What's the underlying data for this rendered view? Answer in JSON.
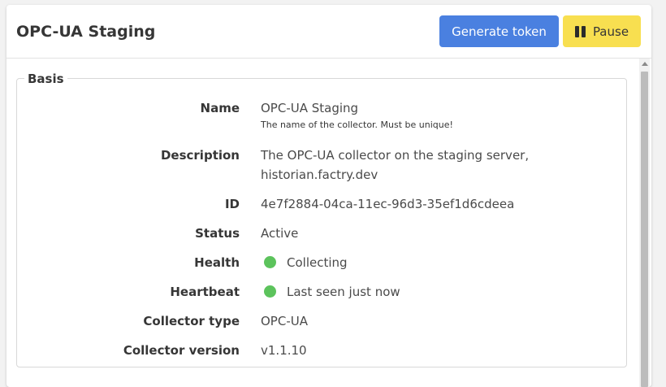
{
  "header": {
    "title": "OPC-UA Staging",
    "generate_token_label": "Generate token",
    "pause_label": "Pause"
  },
  "basis": {
    "legend": "Basis",
    "fields": {
      "name": {
        "label": "Name",
        "value": "OPC-UA Staging",
        "help": "The name of the collector. Must be unique!"
      },
      "description": {
        "label": "Description",
        "value": "The OPC-UA collector on the staging server, historian.factry.dev"
      },
      "id": {
        "label": "ID",
        "value": "4e7f2884-04ca-11ec-96d3-35ef1d6cdeea"
      },
      "status": {
        "label": "Status",
        "value": "Active"
      },
      "health": {
        "label": "Health",
        "value": "Collecting"
      },
      "heartbeat": {
        "label": "Heartbeat",
        "value": "Last seen just now"
      },
      "collector_type": {
        "label": "Collector type",
        "value": "OPC-UA"
      },
      "collector_version": {
        "label": "Collector version",
        "value": "v1.1.10"
      }
    }
  },
  "colors": {
    "primary": "#4a80e0",
    "warning": "#f8df50",
    "success": "#5cc35c"
  },
  "icons": {
    "pause": "pause-icon",
    "health_status": "status-dot-icon",
    "heartbeat_status": "status-dot-icon"
  }
}
